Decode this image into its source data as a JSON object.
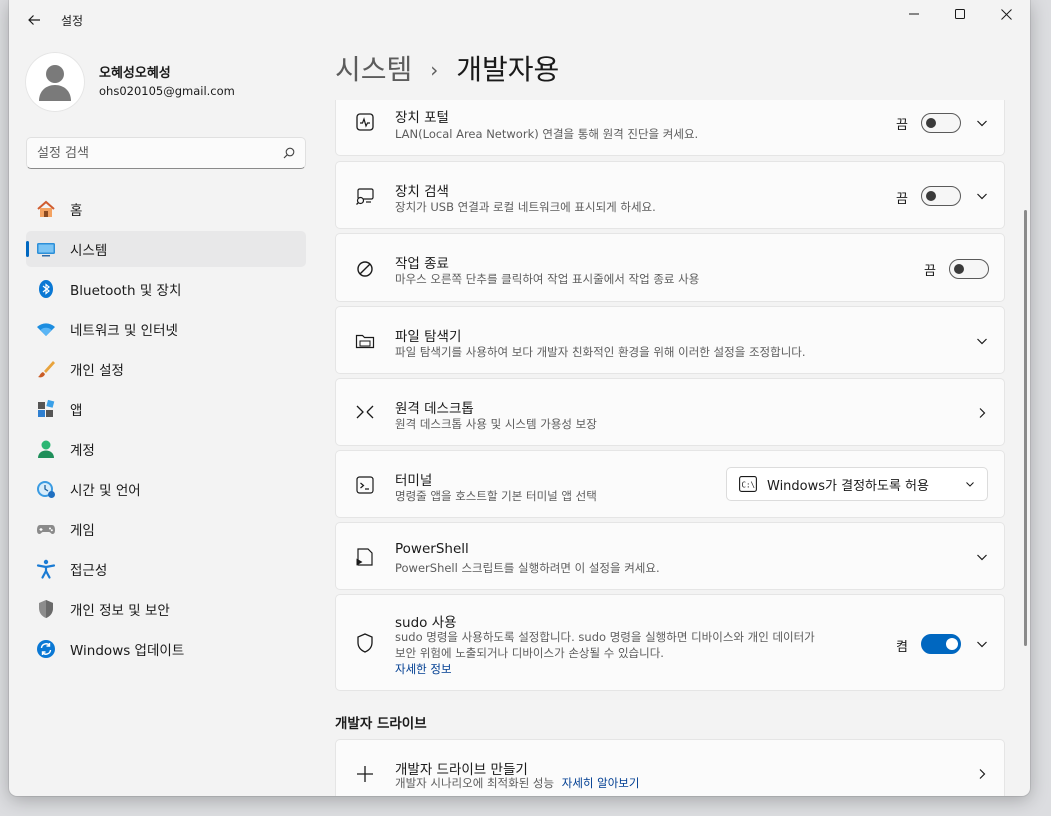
{
  "app": {
    "title": "설정"
  },
  "profile": {
    "name": "오혜성오혜성",
    "email": "ohs020105@gmail.com"
  },
  "search": {
    "placeholder": "설정 검색"
  },
  "nav": [
    {
      "label": "홈",
      "icon": "home-icon"
    },
    {
      "label": "시스템",
      "icon": "system-icon",
      "active": true
    },
    {
      "label": "Bluetooth 및 장치",
      "icon": "bluetooth-icon"
    },
    {
      "label": "네트워크 및 인터넷",
      "icon": "wifi-icon"
    },
    {
      "label": "개인 설정",
      "icon": "brush-icon"
    },
    {
      "label": "앱",
      "icon": "apps-icon"
    },
    {
      "label": "계정",
      "icon": "account-icon"
    },
    {
      "label": "시간 및 언어",
      "icon": "time-language-icon"
    },
    {
      "label": "게임",
      "icon": "gamepad-icon"
    },
    {
      "label": "접근성",
      "icon": "accessibility-icon"
    },
    {
      "label": "개인 정보 및 보안",
      "icon": "shield-icon"
    },
    {
      "label": "Windows 업데이트",
      "icon": "update-icon"
    }
  ],
  "breadcrumb": {
    "parent": "시스템",
    "separator": "›",
    "current": "개발자용"
  },
  "settings": {
    "device_portal": {
      "title": "장치 포털",
      "desc": "LAN(Local Area Network) 연결을 통해 원격 진단을 켜세요.",
      "state": "끔"
    },
    "device_discovery": {
      "title": "장치 검색",
      "desc": "장치가 USB 연결과 로컬 네트워크에 표시되게 하세요.",
      "state": "끔"
    },
    "end_task": {
      "title": "작업 종료",
      "desc": "마우스 오른쪽 단추를 클릭하여 작업 표시줄에서 작업 종료 사용",
      "state": "끔"
    },
    "file_explorer": {
      "title": "파일 탐색기",
      "desc": "파일 탐색기를 사용하여 보다 개발자 친화적인 환경을 위해 이러한 설정을 조정합니다."
    },
    "remote_desktop": {
      "title": "원격 데스크톱",
      "desc": "원격 데스크톱 사용 및 시스템 가용성 보장"
    },
    "terminal": {
      "title": "터미널",
      "desc": "명령줄 앱을 호스트할 기본 터미널 앱 선택",
      "dropdown_value": "Windows가 결정하도록 허용"
    },
    "powershell": {
      "title": "PowerShell",
      "desc": "PowerShell 스크립트를 실행하려면 이 설정을 켜세요."
    },
    "sudo": {
      "title": "sudo 사용",
      "desc_line1": "sudo 명령을 사용하도록 설정합니다. sudo 명령을 실행하면 디바이스와 개인 데이터가",
      "desc_line2": "보안 위험에 노출되거나 디바이스가 손상될 수 있습니다.",
      "link": "자세한 정보",
      "state": "켬"
    }
  },
  "dev_drive": {
    "section_title": "개발자 드라이브",
    "create": {
      "title": "개발자 드라이브 만들기",
      "desc": "개발자 시나리오에 최적화된 성능",
      "link": "자세히 알아보기"
    }
  },
  "colors": {
    "accent": "#0067c0",
    "link": "#003e92"
  }
}
